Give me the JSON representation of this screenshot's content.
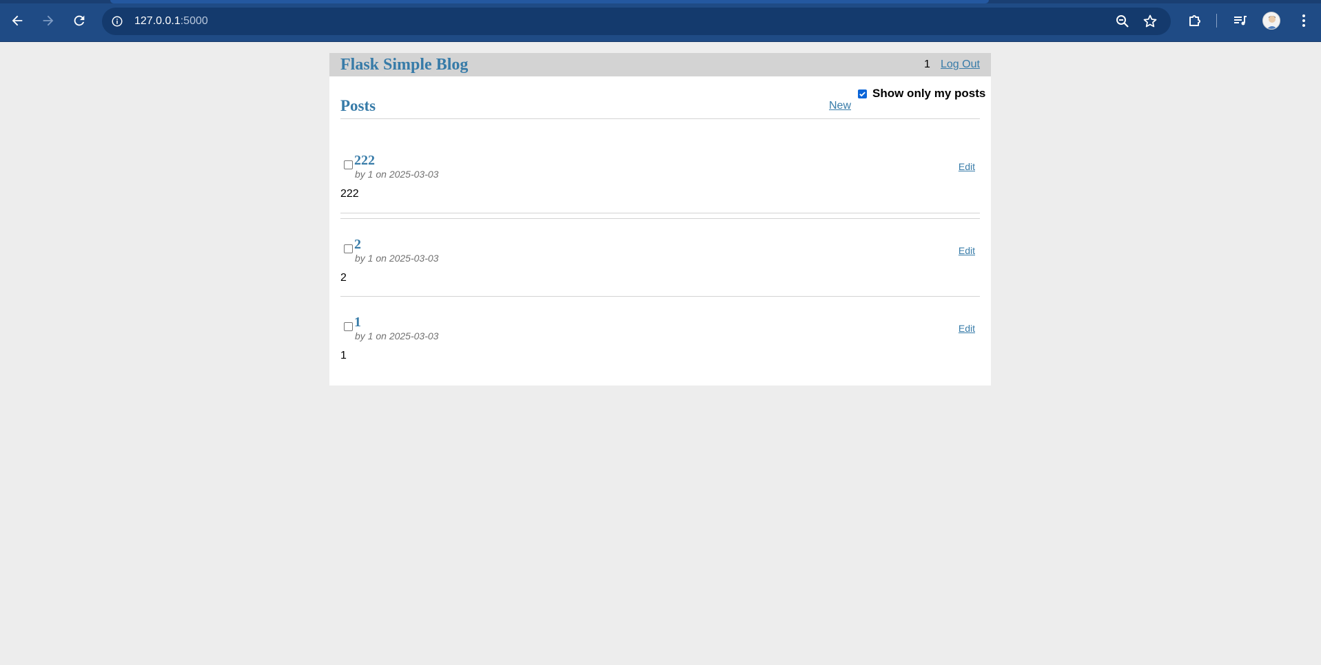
{
  "browser": {
    "url_host": "127.0.0.1",
    "url_port": ":5000",
    "icons": [
      "back-arrow-icon",
      "forward-arrow-icon",
      "reload-icon",
      "site-info-icon",
      "zoom-icon",
      "bookmark-star-icon",
      "extensions-icon",
      "media-controls-icon",
      "profile-avatar",
      "menu-kebab-icon"
    ]
  },
  "header": {
    "site_title": "Flask Simple Blog",
    "username": "1",
    "logout_label": "Log Out"
  },
  "filter": {
    "label": "Show only my posts",
    "checked": true
  },
  "posts_section": {
    "heading": "Posts",
    "new_label": "New"
  },
  "posts": [
    {
      "title": "222",
      "meta": "by 1 on 2025-03-03",
      "body": "222",
      "edit_label": "Edit"
    },
    {
      "title": "2",
      "meta": "by 1 on 2025-03-03",
      "body": "2",
      "edit_label": "Edit"
    },
    {
      "title": "1",
      "meta": "by 1 on 2025-03-03",
      "body": "1",
      "edit_label": "Edit"
    }
  ],
  "colors": {
    "link": "#377ba8",
    "header_bg": "#d3d3d3",
    "chrome_bg": "#1f4b85",
    "page_bg": "#ededed",
    "checkbox_accent": "#0b65d8"
  }
}
